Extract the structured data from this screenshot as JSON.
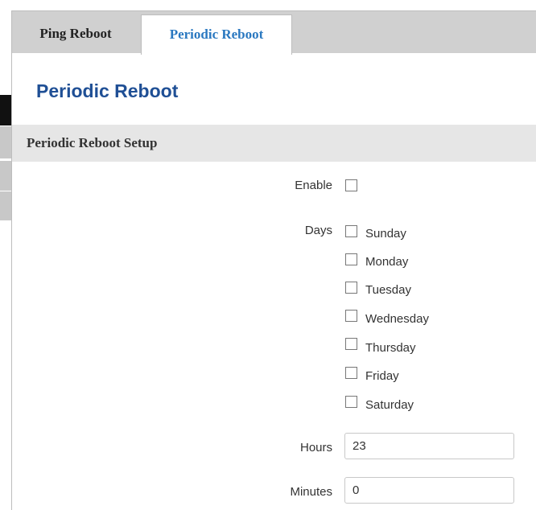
{
  "tabs": [
    {
      "label": "Ping Reboot",
      "active": false
    },
    {
      "label": "Periodic Reboot",
      "active": true
    }
  ],
  "page_title": "Periodic Reboot",
  "section_title": "Periodic Reboot Setup",
  "form": {
    "enable_label": "Enable",
    "enable_checked": false,
    "days_label": "Days",
    "days": [
      {
        "label": "Sunday",
        "checked": false
      },
      {
        "label": "Monday",
        "checked": false
      },
      {
        "label": "Tuesday",
        "checked": false
      },
      {
        "label": "Wednesday",
        "checked": false
      },
      {
        "label": "Thursday",
        "checked": false
      },
      {
        "label": "Friday",
        "checked": false
      },
      {
        "label": "Saturday",
        "checked": false
      }
    ],
    "hours_label": "Hours",
    "hours_value": "23",
    "minutes_label": "Minutes",
    "minutes_value": "0"
  },
  "colors": {
    "active_tab_text": "#2a78c0",
    "title": "#1f4f95",
    "tabbar_bg": "#d0d0d0",
    "section_bg": "#e6e6e6"
  }
}
